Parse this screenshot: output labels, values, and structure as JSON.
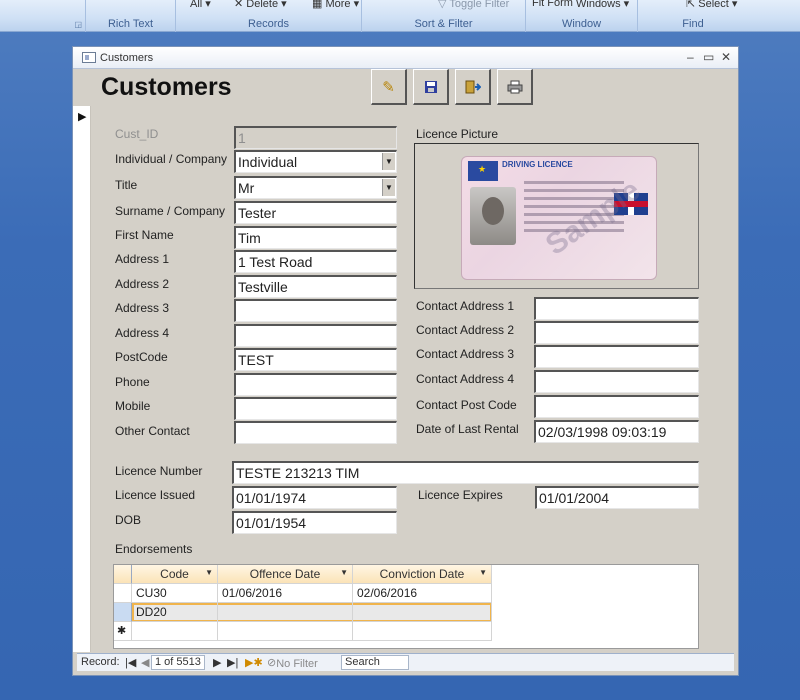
{
  "ribbon": {
    "groups": [
      {
        "label": "Rich Text"
      },
      {
        "label": "Records",
        "buttons": [
          "All",
          "Delete",
          "More"
        ]
      },
      {
        "label": "Sort & Filter",
        "buttons": [
          "Toggle Filter"
        ]
      },
      {
        "label": "Window",
        "buttons": [
          "Fit Form",
          "Windows"
        ]
      },
      {
        "label": "Find",
        "buttons": [
          "Select"
        ]
      }
    ]
  },
  "window": {
    "title": "Customers",
    "minimize": "–",
    "restore": "▭",
    "close": "✕"
  },
  "form": {
    "title": "Customers",
    "toolbar": [
      "edit-pencil",
      "save-disk",
      "exit-door",
      "print"
    ],
    "fields": {
      "cust_id": {
        "label": "Cust_ID",
        "value": "1"
      },
      "individual_company": {
        "label": "Individual / Company",
        "value": "Individual"
      },
      "title": {
        "label": "Title",
        "value": "Mr"
      },
      "surname": {
        "label": "Surname / Company",
        "value": "Tester"
      },
      "first_name": {
        "label": "First Name",
        "value": "Tim"
      },
      "address1": {
        "label": "Address 1",
        "value": "1 Test Road"
      },
      "address2": {
        "label": "Address 2",
        "value": "Testville"
      },
      "address3": {
        "label": "Address 3",
        "value": ""
      },
      "address4": {
        "label": "Address 4",
        "value": ""
      },
      "postcode": {
        "label": "PostCode",
        "value": "TEST"
      },
      "phone": {
        "label": "Phone",
        "value": ""
      },
      "mobile": {
        "label": "Mobile",
        "value": ""
      },
      "other_contact": {
        "label": "Other Contact",
        "value": ""
      },
      "licence_picture": {
        "label": "Licence Picture"
      },
      "contact_address1": {
        "label": "Contact Address 1",
        "value": ""
      },
      "contact_address2": {
        "label": "Contact Address 2",
        "value": ""
      },
      "contact_address3": {
        "label": "Contact Address 3",
        "value": ""
      },
      "contact_address4": {
        "label": "Contact Address 4",
        "value": ""
      },
      "contact_post_code": {
        "label": "Contact Post Code",
        "value": ""
      },
      "date_last_rental": {
        "label": "Date of Last Rental",
        "value": "02/03/1998 09:03:19"
      },
      "licence_number": {
        "label": "Licence Number",
        "value": "TESTE 213213 TIM"
      },
      "licence_issued": {
        "label": "Licence Issued",
        "value": "01/01/1974"
      },
      "licence_expires": {
        "label": "Licence Expires",
        "value": "01/01/2004"
      },
      "dob": {
        "label": "DOB",
        "value": "01/01/1954"
      }
    },
    "licence_card": {
      "heading": "DRIVING LICENCE",
      "watermark": "Sample"
    },
    "endorsements": {
      "label": "Endorsements",
      "columns": [
        "Code",
        "Offence Date",
        "Conviction Date"
      ],
      "rows": [
        [
          "CU30",
          "01/06/2016",
          "02/06/2016"
        ],
        [
          "DD20",
          "",
          ""
        ]
      ],
      "new_row_marker": "✱"
    }
  },
  "navigation": {
    "record_label": "Record:",
    "position": "1 of 5513",
    "no_filter": "No Filter",
    "search": "Search"
  }
}
